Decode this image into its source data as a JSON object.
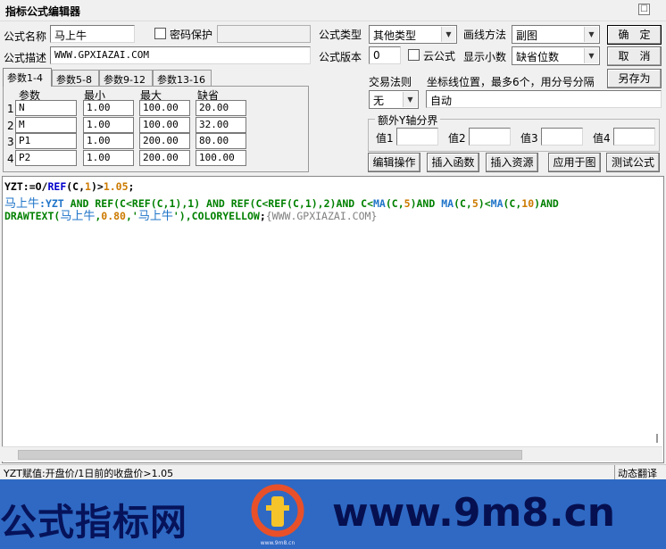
{
  "window": {
    "title": "指标公式编辑器",
    "close_glyph": "☐"
  },
  "form": {
    "formula_name_label": "公式名称",
    "formula_name_value": "马上牛",
    "password_label": "密码保护",
    "description_label": "公式描述",
    "description_value": "WWW.GPXIAZAI.COM",
    "formula_type_label": "公式类型",
    "formula_type_value": "其他类型",
    "draw_method_label": "画线方法",
    "draw_method_value": "副图",
    "version_label": "公式版本",
    "version_value": "0",
    "cloud_label": "云公式",
    "decimals_label": "显示小数",
    "decimals_value": "缺省位数"
  },
  "buttons": {
    "confirm": "确　定",
    "cancel": "取　消",
    "save_as": "另存为",
    "edit_ops": "编辑操作",
    "insert_func": "插入函数",
    "insert_resource": "插入资源",
    "apply_chart": "应用于图",
    "test_formula": "测试公式"
  },
  "tabs": [
    "参数1-4",
    "参数5-8",
    "参数9-12",
    "参数13-16"
  ],
  "params": {
    "headers": [
      "参数",
      "最小",
      "最大",
      "缺省"
    ],
    "rows": [
      {
        "num": "1",
        "name": "N",
        "min": "1.00",
        "max": "100.00",
        "default": "20.00"
      },
      {
        "num": "2",
        "name": "M",
        "min": "1.00",
        "max": "100.00",
        "default": "32.00"
      },
      {
        "num": "3",
        "name": "P1",
        "min": "1.00",
        "max": "200.00",
        "default": "80.00"
      },
      {
        "num": "4",
        "name": "P2",
        "min": "1.00",
        "max": "200.00",
        "default": "100.00"
      }
    ]
  },
  "trade": {
    "rule_label": "交易法则",
    "rule_value": "无",
    "coord_label": "坐标线位置，最多6个，用分号分隔",
    "coord_value": "自动",
    "yaxis_group": "额外Y轴分界",
    "val1": "值1",
    "val2": "值2",
    "val3": "值3",
    "val4": "值4"
  },
  "editor": {
    "line1": [
      {
        "t": "YZT:=O/",
        "c": "#000000"
      },
      {
        "t": "REF",
        "c": "#0000cc"
      },
      {
        "t": "(C,",
        "c": "#000000"
      },
      {
        "t": "1",
        "c": "#cc7a00"
      },
      {
        "t": ")>",
        "c": "#000000"
      },
      {
        "t": "1.05",
        "c": "#cc7a00"
      },
      {
        "t": ";",
        "c": "#000000"
      }
    ],
    "line2": [
      {
        "t": "马上牛",
        "c": "#1f74c8",
        "cn": true
      },
      {
        "t": ":YZT ",
        "c": "#1f74c8"
      },
      {
        "t": "AND ",
        "c": "#008000"
      },
      {
        "t": "REF",
        "c": "#008000"
      },
      {
        "t": "(C<",
        "c": "#008000"
      },
      {
        "t": "REF",
        "c": "#008000"
      },
      {
        "t": "(C,",
        "c": "#008000"
      },
      {
        "t": "1",
        "c": "#008000"
      },
      {
        "t": "),",
        "c": "#008000"
      },
      {
        "t": "1",
        "c": "#008000"
      },
      {
        "t": ") AND REF(C<REF(C,1),2)AND C<",
        "c": "#008000"
      },
      {
        "t": "MA",
        "c": "#1f74c8"
      },
      {
        "t": "(C,",
        "c": "#008000"
      },
      {
        "t": "5",
        "c": "#cc7a00"
      },
      {
        "t": ")AND ",
        "c": "#008000"
      },
      {
        "t": "MA",
        "c": "#1f74c8"
      },
      {
        "t": "(C,",
        "c": "#008000"
      },
      {
        "t": "5",
        "c": "#cc7a00"
      },
      {
        "t": ")<",
        "c": "#008000"
      },
      {
        "t": "MA",
        "c": "#1f74c8"
      },
      {
        "t": "(C,",
        "c": "#008000"
      },
      {
        "t": "10",
        "c": "#cc7a00"
      },
      {
        "t": ")AND",
        "c": "#008000"
      }
    ],
    "line3": [
      {
        "t": "DRAWTEXT",
        "c": "#008000"
      },
      {
        "t": "(",
        "c": "#008000"
      },
      {
        "t": "马上牛",
        "c": "#1f74c8",
        "cn": true
      },
      {
        "t": ",",
        "c": "#008000"
      },
      {
        "t": "0.80",
        "c": "#cc7a00"
      },
      {
        "t": ",'",
        "c": "#008000"
      },
      {
        "t": "马上牛",
        "c": "#1f74c8",
        "cn": true
      },
      {
        "t": "'),",
        "c": "#008000"
      },
      {
        "t": "COLORYELLOW",
        "c": "#008000"
      },
      {
        "t": ";",
        "c": "#000000"
      },
      {
        "t": "{WWW.GPXIAZAI.COM}",
        "c": "#808080",
        "n": true
      }
    ]
  },
  "status": {
    "text": "YZT赋值:开盘价/1日前的收盘价>1.05",
    "translate_button": "动态翻译"
  },
  "banner": {
    "left_text": "公式指标网",
    "right_text": "www.9m8.cn",
    "logo_text": "www.9m8.cn"
  },
  "colors": {
    "banner_bg": "#2f69c3",
    "banner_text": "#061050",
    "logo_orange": "#e8502a",
    "logo_yellow": "#f5c42a"
  }
}
